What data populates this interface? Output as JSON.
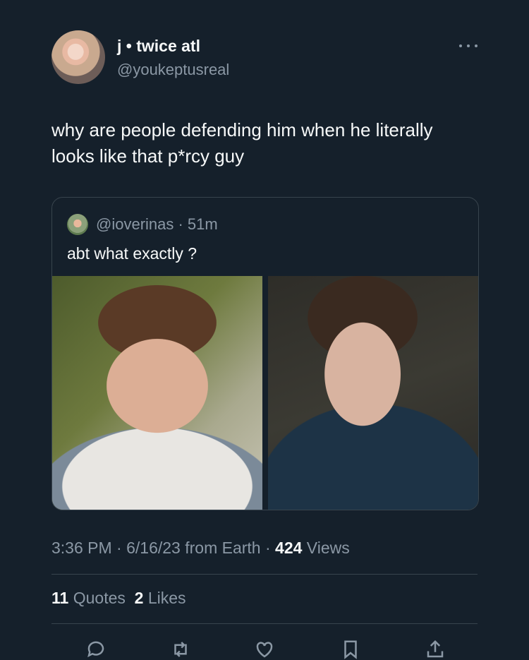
{
  "tweet": {
    "author": {
      "display_name": "j • twice atl",
      "handle": "@youkeptusreal"
    },
    "text": "why are people defending him when he literally looks like that p*rcy guy",
    "quoted": {
      "handle_time": "@ioverinas · 51m",
      "text": "abt what exactly ?"
    },
    "meta": {
      "time_date": "3:36 PM · 6/16/23 from Earth · ",
      "views_count": "424",
      "views_label": " Views"
    },
    "stats": {
      "quotes_count": "11",
      "quotes_label": " Quotes  ",
      "likes_count": "2",
      "likes_label": " Likes"
    },
    "actions": [
      "reply-icon",
      "retweet-icon",
      "like-icon",
      "bookmark-icon",
      "share-icon"
    ]
  },
  "colors": {
    "background": "#15202b",
    "text": "#f7f9f9",
    "muted": "#8b98a5",
    "border": "#38444d"
  }
}
